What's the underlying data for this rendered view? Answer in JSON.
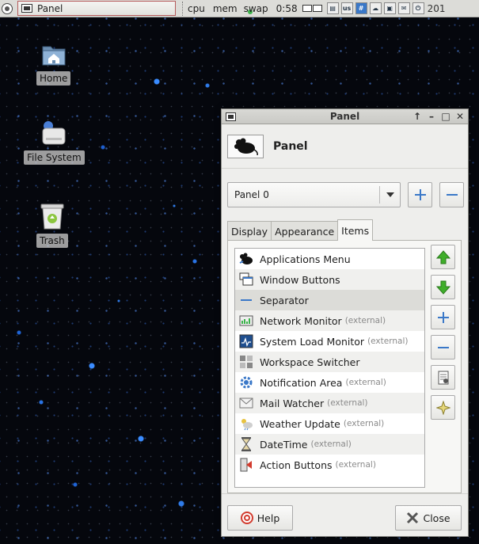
{
  "top_panel": {
    "task_label": "Panel",
    "cpu_label": "cpu",
    "mem_label": "mem",
    "swap_label": "swap",
    "time": "0:58",
    "layout_indicator": "us",
    "clock_partial": "201"
  },
  "desktop": {
    "icons": [
      {
        "label": "Home",
        "icon": "home-folder-icon"
      },
      {
        "label": "File System",
        "icon": "drive-icon"
      },
      {
        "label": "Trash",
        "icon": "trash-icon"
      }
    ]
  },
  "window": {
    "title": "Panel",
    "header_title": "Panel",
    "panel_select_value": "Panel 0",
    "tabs": [
      {
        "label": "Display"
      },
      {
        "label": "Appearance"
      },
      {
        "label": "Items",
        "active": true
      }
    ],
    "external_suffix": "(external)",
    "items": [
      {
        "name": "Applications Menu",
        "external": false,
        "icon": "mouse-icon"
      },
      {
        "name": "Window Buttons",
        "external": false,
        "icon": "window-buttons-icon"
      },
      {
        "name": "Separator",
        "external": false,
        "icon": "separator-icon",
        "selected": true
      },
      {
        "name": "Network Monitor",
        "external": true,
        "icon": "network-monitor-icon"
      },
      {
        "name": "System Load Monitor",
        "external": true,
        "icon": "system-load-icon"
      },
      {
        "name": "Workspace Switcher",
        "external": false,
        "icon": "workspace-switcher-icon"
      },
      {
        "name": "Notification Area",
        "external": true,
        "icon": "notification-gear-icon"
      },
      {
        "name": "Mail Watcher",
        "external": true,
        "icon": "mail-icon"
      },
      {
        "name": "Weather Update",
        "external": true,
        "icon": "weather-icon"
      },
      {
        "name": "DateTime",
        "external": true,
        "icon": "hourglass-icon"
      },
      {
        "name": "Action Buttons",
        "external": true,
        "icon": "action-buttons-icon"
      }
    ],
    "help_label": "Help",
    "close_label": "Close"
  },
  "colors": {
    "up_arrow": "#3fae2a",
    "add_blue": "#3a78c8",
    "remove_blue": "#3a78c8",
    "close_x": "#555555",
    "help_red": "#d23b2e"
  }
}
